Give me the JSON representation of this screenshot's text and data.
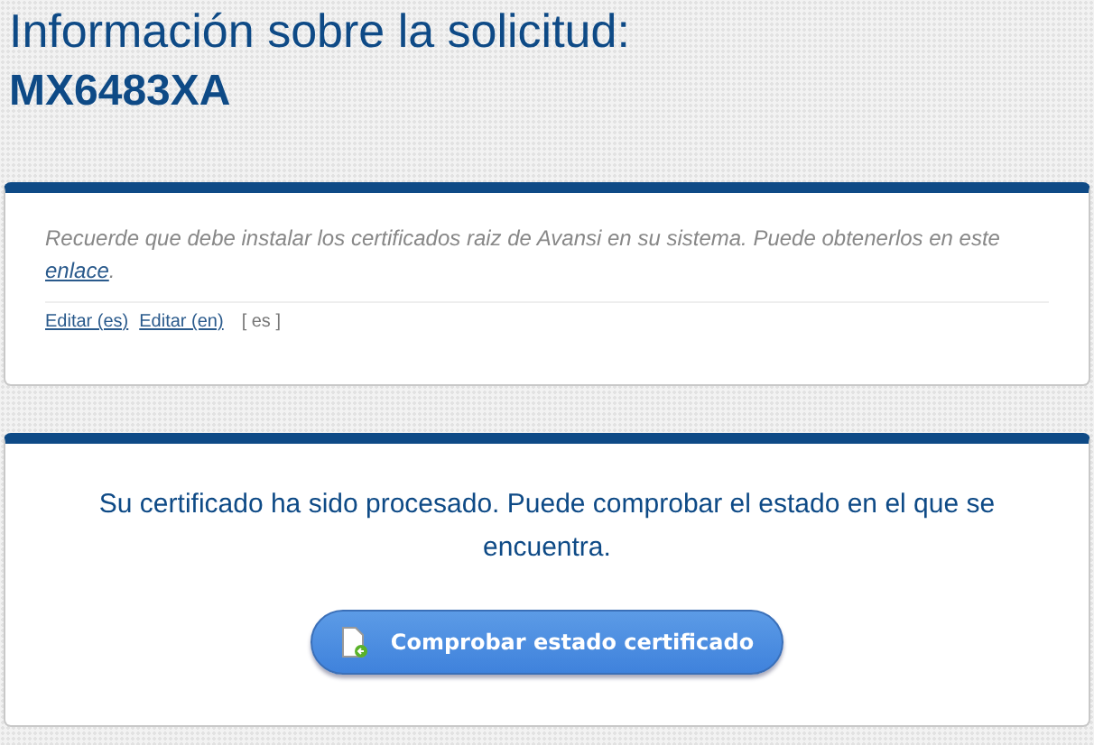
{
  "heading": {
    "title": "Información sobre la solicitud:",
    "code": "MX6483XA"
  },
  "notice": {
    "text": "Recuerde que debe instalar los certificados raiz de Avansi en su sistema. Puede obtenerlos en este ",
    "link": "enlace",
    "after": ".",
    "edit_links": [
      "Editar (es)",
      "Editar (en)"
    ],
    "language": "[ es ]"
  },
  "status": {
    "message": "Su certificado ha sido procesado. Puede comprobar el estado en el que se encuentra.",
    "button": "Comprobar estado certificado"
  }
}
